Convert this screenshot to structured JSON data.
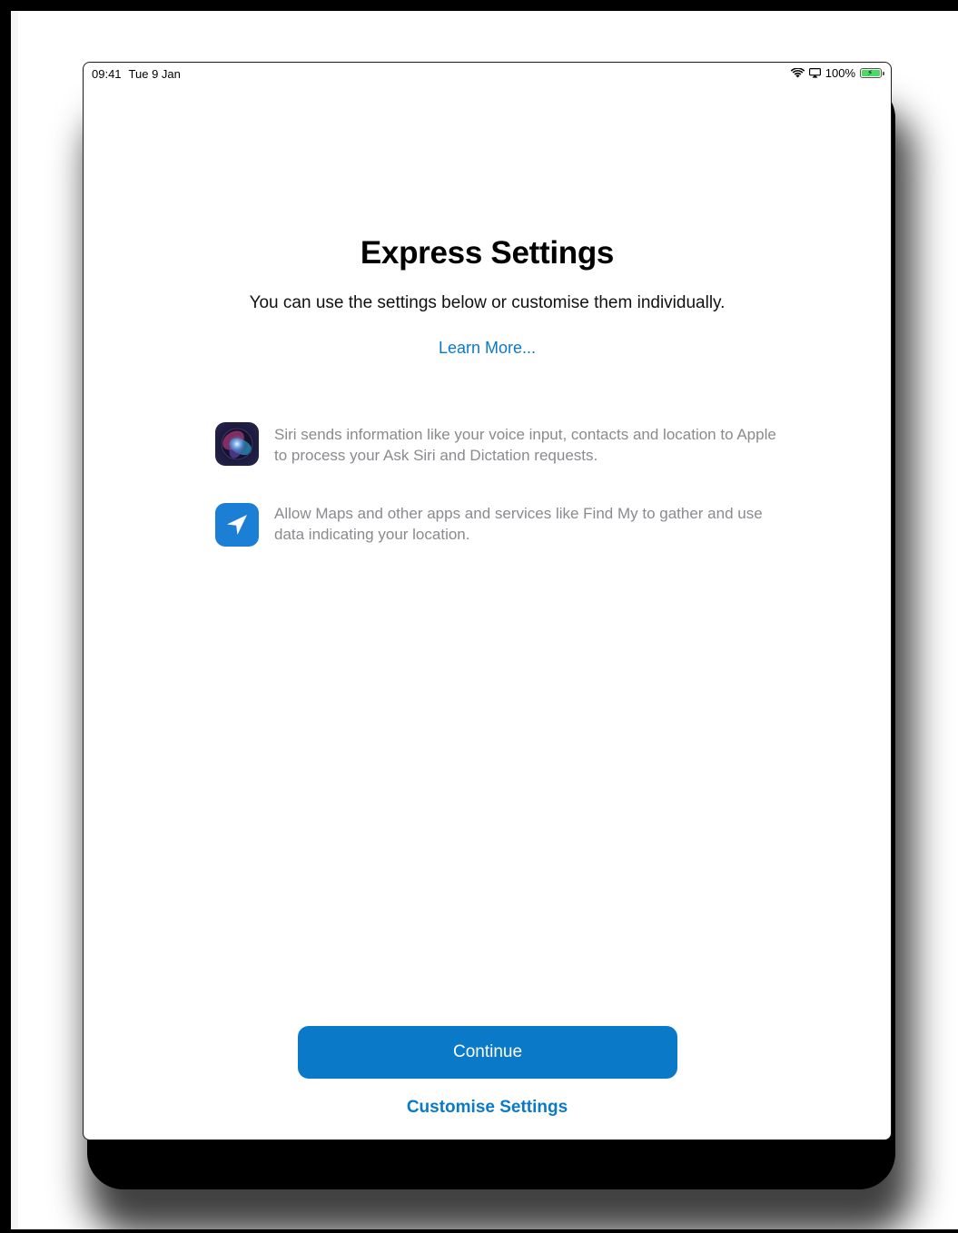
{
  "status_bar": {
    "time": "09:41",
    "date": "Tue 9 Jan",
    "battery_percent": "100%",
    "battery_level": 1.0,
    "battery_color": "#4cd964",
    "icons": [
      "wifi-icon",
      "airplay-icon",
      "battery-charging-icon"
    ]
  },
  "page": {
    "title": "Express Settings",
    "subtitle": "You can use the settings below or customise them individually.",
    "learn_more": "Learn More..."
  },
  "info_items": [
    {
      "icon": "siri-icon",
      "text": "Siri sends information like your voice input, contacts and location to Apple to process your Ask Siri and Dictation requests."
    },
    {
      "icon": "location-arrow-icon",
      "text": "Allow Maps and other apps and services like Find My to gather and use data indicating your location."
    }
  ],
  "actions": {
    "continue_label": "Continue",
    "customise_label": "Customise Settings"
  },
  "colors": {
    "accent": "#0a7ac8",
    "secondary_text": "#8a8a8f",
    "location_icon_bg": "#1b7fd6"
  }
}
